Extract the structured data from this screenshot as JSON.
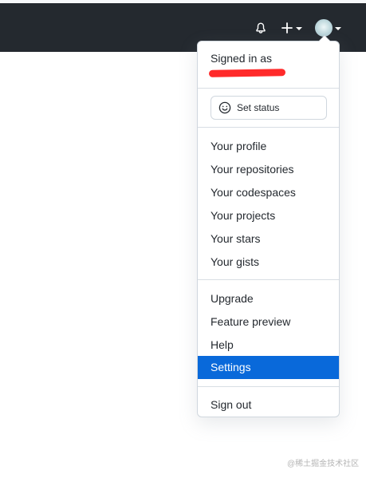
{
  "header": {
    "icons": [
      "bell-icon",
      "plus-icon",
      "avatar",
      "chevron-down-icon"
    ]
  },
  "dropdown": {
    "signed_in_label": "Signed in as",
    "set_status_label": "Set status",
    "status_icon": "smiley-icon",
    "profile_links": [
      "Your profile",
      "Your repositories",
      "Your codespaces",
      "Your projects",
      "Your stars",
      "Your gists"
    ],
    "account_links": [
      "Upgrade",
      "Feature preview",
      "Help",
      "Settings"
    ],
    "sign_out_label": "Sign out",
    "active_item": "Settings"
  },
  "watermark": {
    "text": "@稀土掘金技术社区"
  },
  "colors": {
    "header_background": "#24292f",
    "highlight": "#0969da",
    "redaction": "#ff2a2a"
  }
}
